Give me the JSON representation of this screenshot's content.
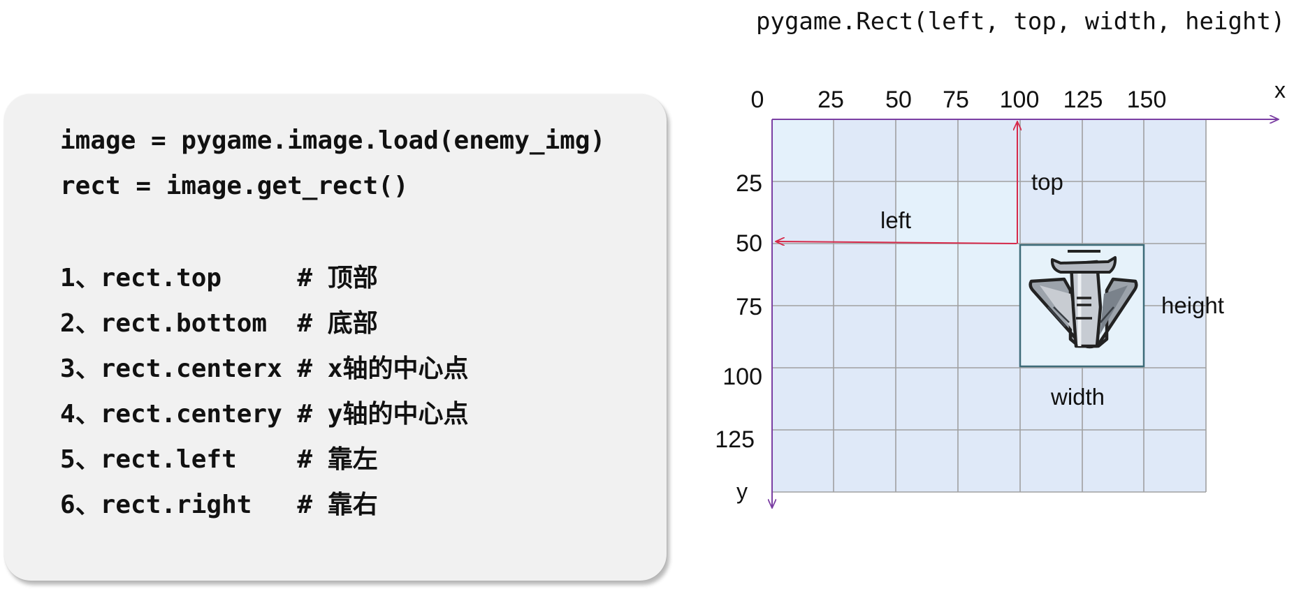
{
  "code": {
    "lines": [
      "image = pygame.image.load(enemy_img)",
      "rect = image.get_rect()",
      "1、rect.top     # 顶部",
      "2、rect.bottom  # 底部",
      "3、rect.centerx # x轴的中心点",
      "4、rect.centery # y轴的中心点",
      "5、rect.left    # 靠左",
      "6、rect.right   # 靠右"
    ]
  },
  "diagram": {
    "signature": "pygame.Rect(left, top, width, height)",
    "x_axis_label": "x",
    "y_axis_label": "y",
    "x_ticks": [
      "0",
      "25",
      "50",
      "75",
      "100",
      "125",
      "150"
    ],
    "y_ticks": [
      "25",
      "50",
      "75",
      "100",
      "125"
    ],
    "annotations": {
      "left": "left",
      "top": "top",
      "width": "width",
      "height": "height"
    },
    "sprite_icon": "enemy-plane-icon",
    "colors": {
      "grid_fill": "#dfe9f8",
      "grid_line": "#a0a0a0",
      "axis": "#7b3fa3",
      "arrow": "#d6294a",
      "sprite_border": "#3d6b78"
    }
  }
}
